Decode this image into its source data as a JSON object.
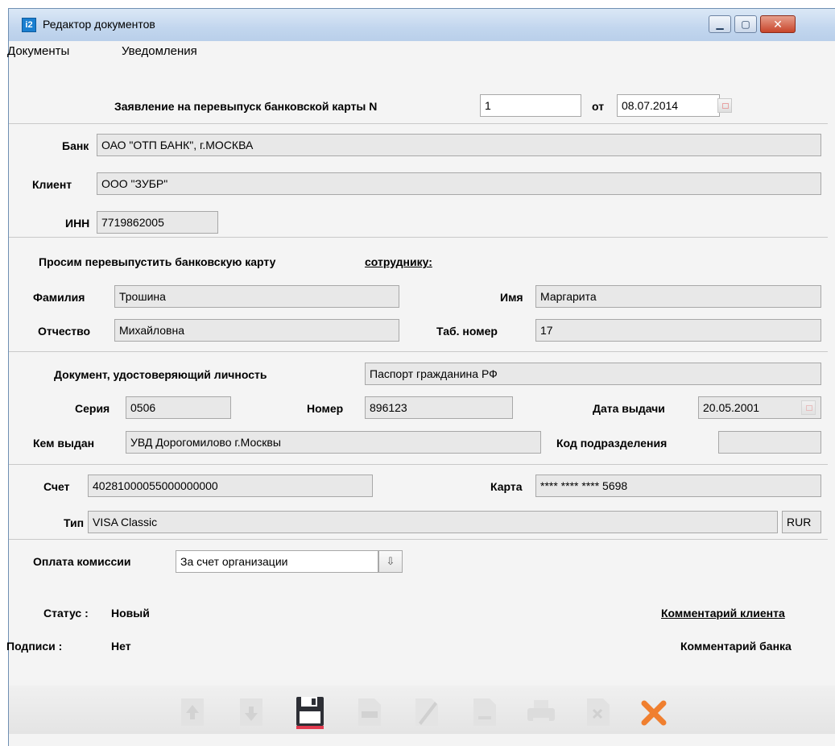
{
  "window": {
    "title": "Редактор документов",
    "icon_text": "i2",
    "controls": {
      "minimize": "▁",
      "maximize": "▢",
      "close": "✕"
    }
  },
  "menu": [
    "Документы",
    "Уведомления"
  ],
  "header": {
    "doc_title": "Заявление на перевыпуск банковской карты N",
    "doc_number": "1",
    "date_label": "от",
    "date": "08.07.2014"
  },
  "org": {
    "bank_label": "Банк",
    "bank": "ОАО \"ОТП БАНК\", г.МОСКВА",
    "client_label": "Клиент",
    "client": "ООО \"ЗУБР\"",
    "inn_label": "ИНН",
    "inn": "7719862005"
  },
  "employee": {
    "request_text": "Просим перевыпустить банковскую карту",
    "request_link": "сотруднику:",
    "surname_label": "Фамилия",
    "surname": "Трошина",
    "name_label": "Имя",
    "name": "Маргарита",
    "patronymic_label": "Отчество",
    "patronymic": "Михайловна",
    "tab_label": "Таб. номер",
    "tab_number": "17"
  },
  "identity": {
    "doc_label": "Документ, удостоверяющий личность",
    "doc_type": "Паспорт гражданина РФ",
    "series_label": "Серия",
    "series": "0506",
    "number_label": "Номер",
    "number": "896123",
    "issue_date_label": "Дата выдачи",
    "issue_date": "20.05.2001",
    "issued_by_label": "Кем выдан",
    "issued_by": "УВД Дорогомилово г.Москвы",
    "dept_code_label": "Код подразделения",
    "dept_code": ""
  },
  "card": {
    "account_label": "Счет",
    "account": "40281000055000000000",
    "card_label": "Карта",
    "card_number": "**** **** **** 5698",
    "type_label": "Тип",
    "type": "VISA Classic",
    "currency": "RUR"
  },
  "commission": {
    "label": "Оплата комиссии",
    "value": "За счет организации"
  },
  "status": {
    "status_label": "Статус :",
    "status_value": "Новый",
    "signatures_label": "Подписи :",
    "signatures_value": "Нет",
    "client_comment": "Комментарий клиента",
    "bank_comment": "Комментарий банка"
  },
  "toolbar_icons": [
    "arrow-up-icon",
    "arrow-down-icon",
    "save-icon",
    "import-icon",
    "edit-icon",
    "copy-icon",
    "print-icon",
    "delete-doc-icon",
    "close-icon"
  ]
}
